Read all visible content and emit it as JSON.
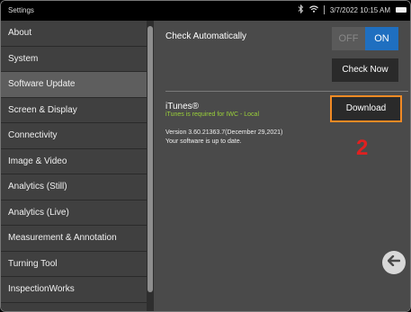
{
  "status_bar": {
    "title": "Settings",
    "datetime": "3/7/2022  10:15 AM",
    "icons": [
      "bluetooth-icon",
      "wifi-icon",
      "battery-icon"
    ]
  },
  "sidebar": {
    "items": [
      {
        "label": "About",
        "selected": false
      },
      {
        "label": "System",
        "selected": false
      },
      {
        "label": "Software Update",
        "selected": true
      },
      {
        "label": "Screen & Display",
        "selected": false
      },
      {
        "label": "Connectivity",
        "selected": false
      },
      {
        "label": "Image & Video",
        "selected": false
      },
      {
        "label": "Analytics (Still)",
        "selected": false
      },
      {
        "label": "Analytics (Live)",
        "selected": false
      },
      {
        "label": "Measurement & Annotation",
        "selected": false
      },
      {
        "label": "Turning Tool",
        "selected": false
      },
      {
        "label": "InspectionWorks",
        "selected": false
      }
    ]
  },
  "content": {
    "check_auto_label": "Check Automatically",
    "toggle_off": "OFF",
    "toggle_on": "ON",
    "toggle_state": "ON",
    "check_now_label": "Check Now",
    "itunes_title": "iTunes®",
    "itunes_subtitle": "iTunes is required for IWC - Local",
    "download_label": "Download",
    "version_text": "Version 3.60.21363.7(December 29,2021)",
    "status_text": "Your software is up to date.",
    "callout_number": "2",
    "back_icon": "arrow-left-icon"
  },
  "colors": {
    "accent_blue": "#1f6fc0",
    "highlight_orange": "#f28a24",
    "callout_red": "#e02020",
    "subtitle_green": "#9ad03a"
  }
}
